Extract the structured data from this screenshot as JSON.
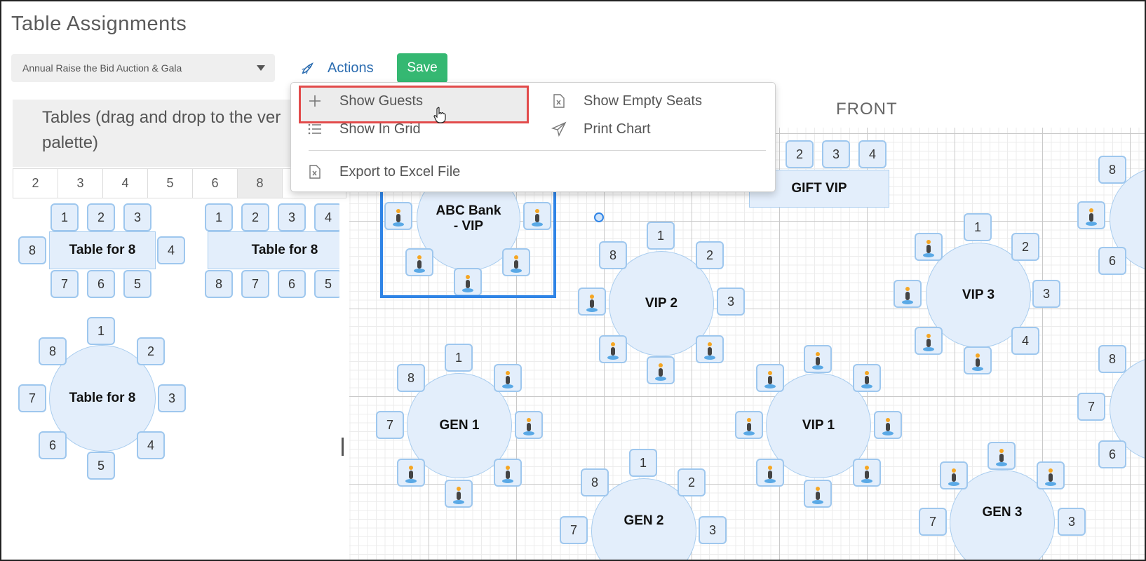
{
  "page": {
    "title": "Table Assignments"
  },
  "toolbar": {
    "event_value": "Annual Raise the Bid Auction & Gala",
    "actions_label": "Actions",
    "save_label": "Save"
  },
  "actions_menu": {
    "show_guests": "Show Guests",
    "show_in_grid": "Show In Grid",
    "export_excel": "Export to Excel File",
    "show_empty_seats": "Show Empty Seats",
    "print_chart": "Print Chart"
  },
  "palette": {
    "heading": "Tables (drag and drop to the ver palette)",
    "tabs": [
      "2",
      "3",
      "4",
      "5",
      "6",
      "8"
    ],
    "active_tab": "8",
    "tables": [
      {
        "label": "Table for 8"
      },
      {
        "label": "Table for 8"
      },
      {
        "label": "Table for 8"
      }
    ]
  },
  "chart": {
    "front_label": "FRONT",
    "tables": {
      "abc": "ABC Bank - VIP",
      "gift": "GIFT VIP",
      "vip2": "VIP 2",
      "vip3": "VIP 3",
      "vip1": "VIP 1",
      "gen1": "GEN 1",
      "gen2": "GEN 2",
      "gen3": "GEN 3"
    }
  },
  "seat_numbers": [
    "1",
    "2",
    "3",
    "4",
    "5",
    "6",
    "7",
    "8"
  ],
  "colors": {
    "accent": "#2b6cb0",
    "save": "#35b872",
    "table_fill": "#e3eefb",
    "seat_border": "#9ec7ee",
    "highlight_box": "#e24b4b",
    "selection": "#2f84e6"
  },
  "icons": {
    "actions": "rocket-icon",
    "show_guests": "plus-icon",
    "show_in_grid": "list-icon",
    "export": "excel-file-icon",
    "empty_seats": "excel-file-icon",
    "print": "paper-plane-icon",
    "guest": "person-icon"
  }
}
